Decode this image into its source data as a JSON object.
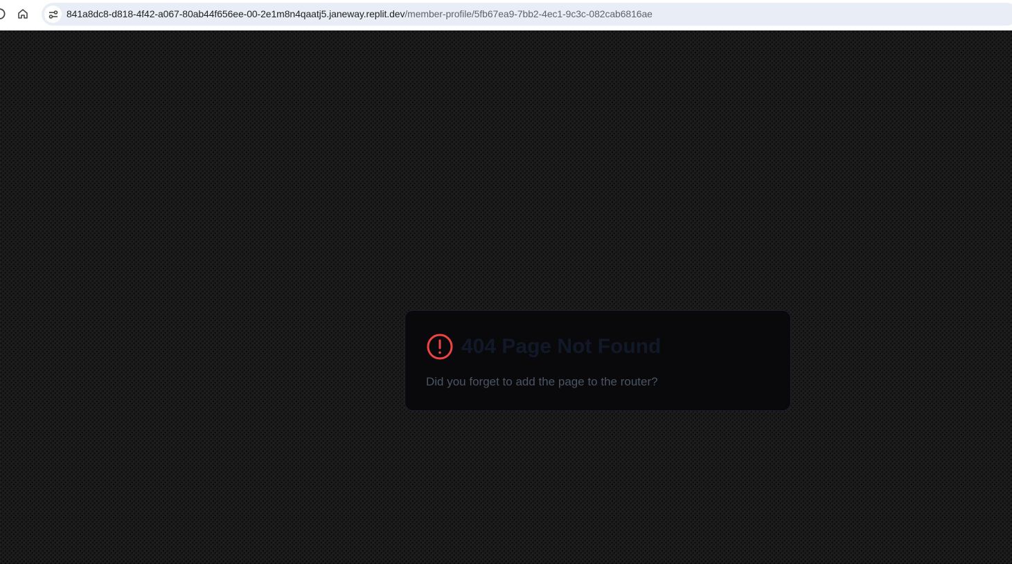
{
  "browser": {
    "url_host": "841a8dc8-d818-4f42-a067-80ab44f656ee-00-2e1m8n4qaatj5.janeway.replit.dev",
    "url_path": "/member-profile/5fb67ea9-7bb2-4ec1-9c3c-082cab6816ae",
    "icons": {
      "reload": "reload-icon",
      "home": "home-icon",
      "site_info": "site-settings-icon"
    }
  },
  "error_card": {
    "title": "404 Page Not Found",
    "description": "Did you forget to add the page to the router?",
    "icon": "alert-circle-icon",
    "icon_color": "#ef4444"
  },
  "colors": {
    "page_background": "#1b1b1b",
    "card_background": "#09090b",
    "title_color": "#111827",
    "description_color": "#4b5563"
  }
}
